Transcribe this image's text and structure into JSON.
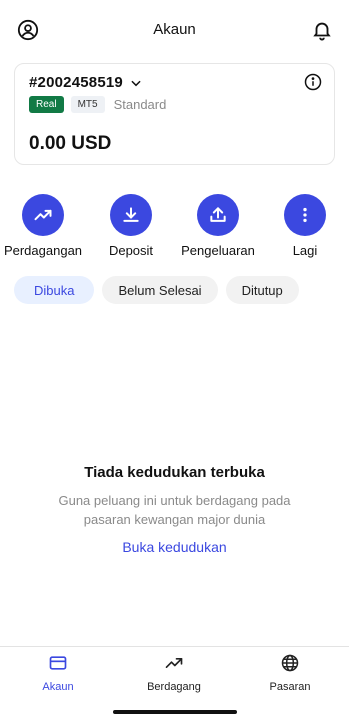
{
  "header": {
    "title": "Akaun",
    "left_icon": "user-circle-icon",
    "right_icon": "bell-icon"
  },
  "account": {
    "number": "#2002458519",
    "tags": {
      "type": "Real",
      "platform": "MT5",
      "variant": "Standard"
    },
    "balance": "0.00 USD"
  },
  "actions": [
    {
      "label": "Perdagangan",
      "icon": "trend-up-icon"
    },
    {
      "label": "Deposit",
      "icon": "download-icon"
    },
    {
      "label": "Pengeluaran",
      "icon": "upload-icon"
    },
    {
      "label": "Lagi",
      "icon": "more-vertical-icon"
    }
  ],
  "tabs": [
    "Dibuka",
    "Belum Selesai",
    "Ditutup"
  ],
  "empty_state": {
    "title": "Tiada kedudukan terbuka",
    "line1": "Guna peluang ini untuk berdagang pada",
    "line2": "pasaran kewangan major dunia",
    "link": "Buka kedudukan"
  },
  "bottom_nav": [
    {
      "label": "Akaun",
      "icon": "card-icon",
      "active": true
    },
    {
      "label": "Berdagang",
      "icon": "trend-up-icon",
      "active": false
    },
    {
      "label": "Pasaran",
      "icon": "globe-icon",
      "active": false
    }
  ],
  "colors": {
    "accent": "#3b48e0",
    "real_tag": "#117a45",
    "muted": "#8a8a8a"
  }
}
